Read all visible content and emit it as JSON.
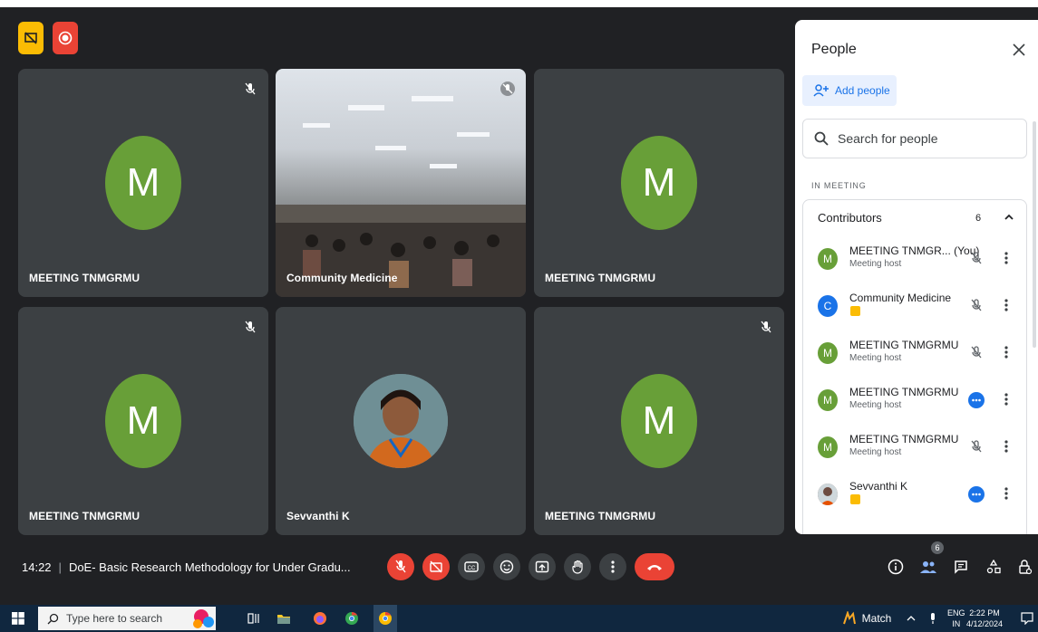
{
  "colors": {
    "accent": "#1a73e8",
    "danger": "#ea4335",
    "present": "#fbbc04",
    "avatar_green": "#689f38",
    "tile_bg": "#3c4043",
    "stage_bg": "#202124"
  },
  "top_badges": [
    {
      "name": "presenting-indicator",
      "icon": "screen-share-off-icon"
    },
    {
      "name": "recording-indicator",
      "icon": "record-icon"
    }
  ],
  "tiles": [
    {
      "name": "MEETING TNMGRMU",
      "avatar_letter": "M",
      "muted": true
    },
    {
      "name": "Community Medicine",
      "video": true,
      "muted": true
    },
    {
      "name": "MEETING TNMGRMU",
      "avatar_letter": "M",
      "muted": false
    },
    {
      "name": "MEETING TNMGRMU",
      "avatar_letter": "M",
      "muted": true
    },
    {
      "name": "Sevvanthi K",
      "photo": true,
      "muted": false
    },
    {
      "name": "MEETING TNMGRMU",
      "avatar_letter": "M",
      "muted": true
    }
  ],
  "people_panel": {
    "title": "People",
    "add_people_label": "Add people",
    "search_placeholder": "Search for people",
    "section_label": "IN MEETING",
    "contributors_label": "Contributors",
    "contributors_count": "6",
    "participants": [
      {
        "avatar_letter": "M",
        "avatar_color": "#689f38",
        "name": "MEETING TNMGR...",
        "you_label": "(You)",
        "subtitle": "Meeting host",
        "status": "muted"
      },
      {
        "avatar_letter": "C",
        "avatar_color": "#1a73e8",
        "name": "Community Medicine",
        "subtitle": "",
        "status": "muted",
        "presenting": true
      },
      {
        "avatar_letter": "M",
        "avatar_color": "#689f38",
        "name": "MEETING TNMGRMU",
        "subtitle": "Meeting host",
        "status": "muted"
      },
      {
        "avatar_letter": "M",
        "avatar_color": "#689f38",
        "name": "MEETING TNMGRMU",
        "subtitle": "Meeting host",
        "status": "talking"
      },
      {
        "avatar_letter": "M",
        "avatar_color": "#689f38",
        "name": "MEETING TNMGRMU",
        "subtitle": "Meeting host",
        "status": "muted"
      },
      {
        "avatar_letter": "",
        "avatar_color": "#8d6e63",
        "name": "Sevvanthi K",
        "subtitle": "",
        "status": "talking",
        "presenting": true,
        "photo": true
      }
    ]
  },
  "meeting_info": {
    "time": "14:22",
    "separator": "|",
    "title": "DoE- Basic Research Methodology for Under Gradu..."
  },
  "controls": [
    "mic-off-icon",
    "camera-off-icon",
    "captions-icon",
    "emoji-icon",
    "present-icon",
    "raise-hand-icon",
    "more-options-icon",
    "end-call-icon"
  ],
  "right_controls": {
    "people_count": "6",
    "icons": [
      "info-icon",
      "people-icon",
      "chat-icon",
      "activities-icon",
      "host-controls-icon"
    ]
  },
  "taskbar": {
    "search_placeholder": "Type here to search",
    "weather_label": "Match",
    "lang_top": "ENG",
    "lang_bottom": "IN",
    "time": "2:22 PM",
    "date": "4/12/2024"
  }
}
